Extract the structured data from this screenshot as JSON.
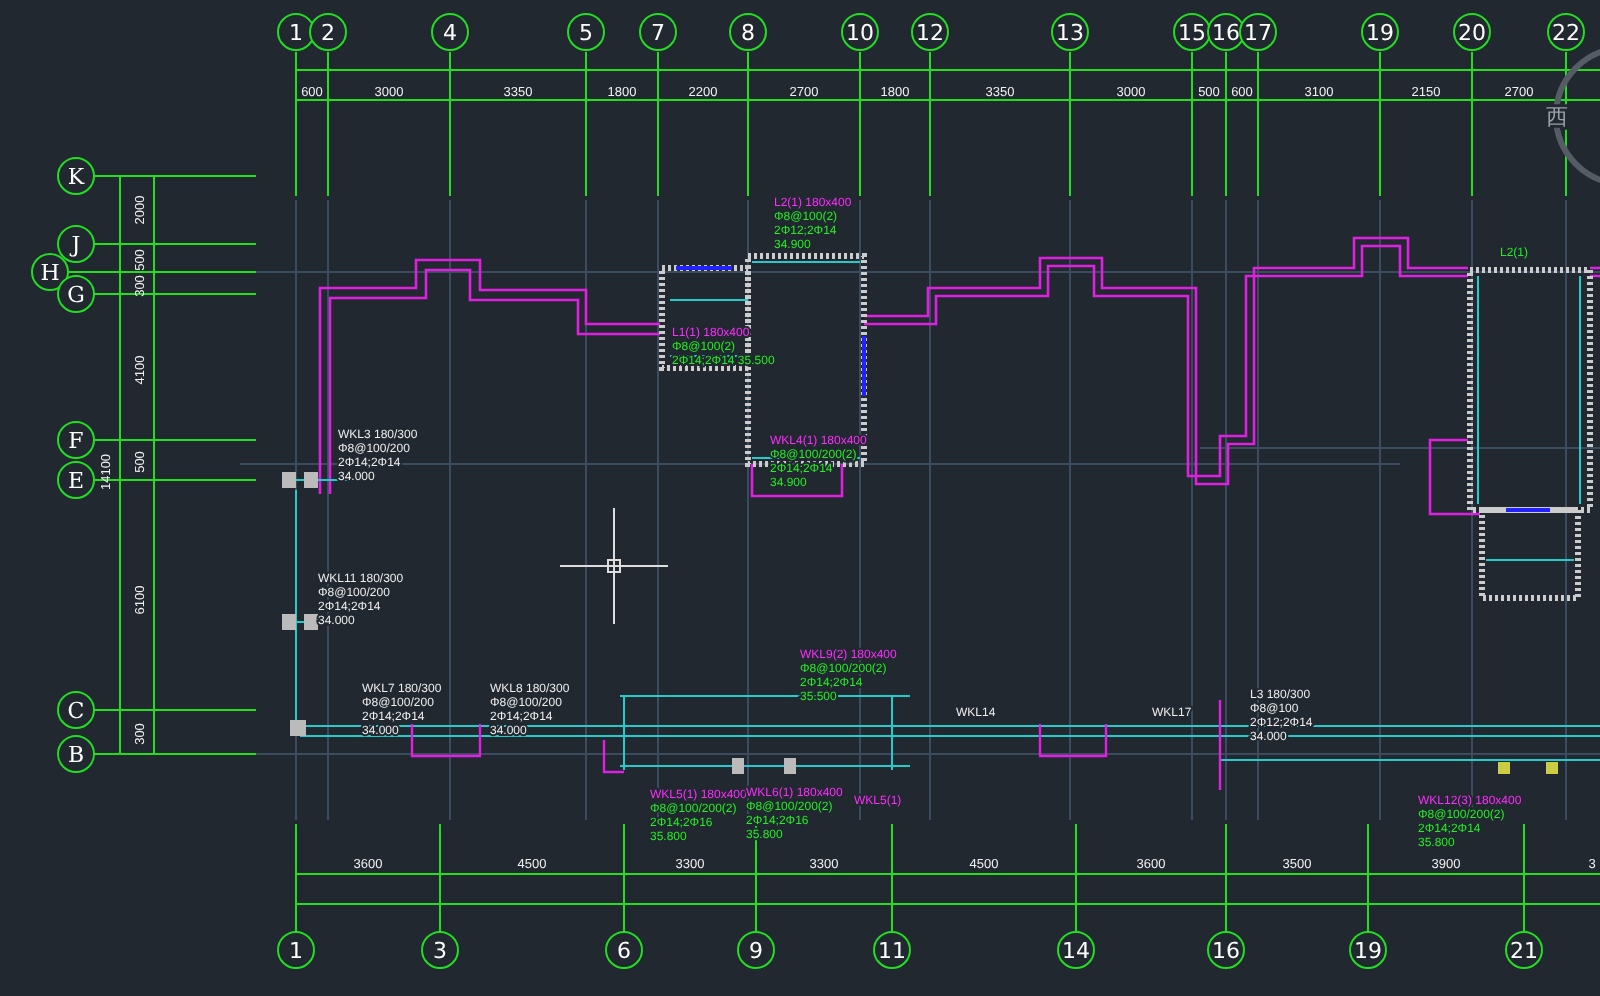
{
  "top_axes": [
    {
      "label": "1"
    },
    {
      "label": "2"
    },
    {
      "label": "4"
    },
    {
      "label": "5"
    },
    {
      "label": "7"
    },
    {
      "label": "8"
    },
    {
      "label": "10"
    },
    {
      "label": "12"
    },
    {
      "label": "13"
    },
    {
      "label": "15"
    },
    {
      "label": "16"
    },
    {
      "label": "17"
    },
    {
      "label": "19"
    },
    {
      "label": "20"
    },
    {
      "label": "22"
    }
  ],
  "top_dimensions": [
    "600",
    "3000",
    "3350",
    "1800",
    "2200",
    "2700",
    "1800",
    "3350",
    "3000",
    "500",
    "600",
    "3100",
    "2150",
    "2700"
  ],
  "left_axes": [
    {
      "label": "K"
    },
    {
      "label": "J"
    },
    {
      "label": "H"
    },
    {
      "label": "G"
    },
    {
      "label": "F"
    },
    {
      "label": "E"
    },
    {
      "label": "C"
    },
    {
      "label": "B"
    }
  ],
  "left_dimensions": [
    "2000",
    "500",
    "300",
    "4100",
    "500",
    "6100",
    "300",
    "14100"
  ],
  "bottom_axes": [
    {
      "label": "1"
    },
    {
      "label": "3"
    },
    {
      "label": "6"
    },
    {
      "label": "9"
    },
    {
      "label": "11"
    },
    {
      "label": "14"
    },
    {
      "label": "16"
    },
    {
      "label": "19"
    },
    {
      "label": "21"
    }
  ],
  "bottom_dimensions": [
    "3600",
    "4500",
    "3300",
    "3300",
    "4500",
    "3600",
    "3500",
    "3900",
    "3"
  ],
  "annotations": [
    {
      "kind": "colored",
      "lines": [
        "L2(1) 180x400",
        "Φ8@100(2)",
        "2Φ12;2Φ14",
        "34.900"
      ]
    },
    {
      "kind": "green-tag",
      "lines": [
        "L2(1)"
      ]
    },
    {
      "kind": "colored",
      "lines": [
        "L1(1) 180x400",
        "Φ8@100(2)",
        "2Φ14;2Φ14 35.500"
      ]
    },
    {
      "kind": "plain",
      "lines": [
        "WKL3 180/300",
        "Φ8@100/200",
        "2Φ14;2Φ14",
        "34.000"
      ]
    },
    {
      "kind": "colored",
      "lines": [
        "WKL4(1) 180x400",
        "Φ8@100/200(2)",
        "2Φ14;2Φ14",
        "34.900"
      ]
    },
    {
      "kind": "plain",
      "lines": [
        "WKL11 180/300",
        "Φ8@100/200",
        "2Φ14;2Φ14",
        "34.000"
      ]
    },
    {
      "kind": "colored",
      "lines": [
        "WKL9(2) 180x400",
        "Φ8@100/200(2)",
        "2Φ14;2Φ14",
        "35.500"
      ]
    },
    {
      "kind": "plain",
      "lines": [
        "WKL7 180/300",
        "Φ8@100/200",
        "2Φ14;2Φ14",
        "34.000"
      ]
    },
    {
      "kind": "plain",
      "lines": [
        "WKL8 180/300",
        "Φ8@100/200",
        "2Φ14;2Φ14",
        "34.000"
      ]
    },
    {
      "kind": "plain",
      "lines": [
        "WKL14"
      ]
    },
    {
      "kind": "plain",
      "lines": [
        "WKL17"
      ]
    },
    {
      "kind": "plain",
      "lines": [
        "L3 180/300",
        "Φ8@100",
        "2Φ12;2Φ14",
        "34.000"
      ]
    },
    {
      "kind": "colored",
      "lines": [
        "WKL5(1) 180x400",
        "Φ8@100/200(2)",
        "2Φ14;2Φ16",
        "35.800"
      ]
    },
    {
      "kind": "colored",
      "lines": [
        "WKL6(1) 180x400",
        "Φ8@100/200(2)",
        "2Φ14;2Φ16",
        "35.800"
      ]
    },
    {
      "kind": "magenta-tag",
      "lines": [
        "WKL5(1)"
      ]
    },
    {
      "kind": "colored",
      "lines": [
        "WKL12(3) 180x400",
        "Φ8@100/200(2)",
        "2Φ14;2Φ14",
        "35.800"
      ]
    }
  ],
  "viewcube": {
    "label": "西"
  }
}
